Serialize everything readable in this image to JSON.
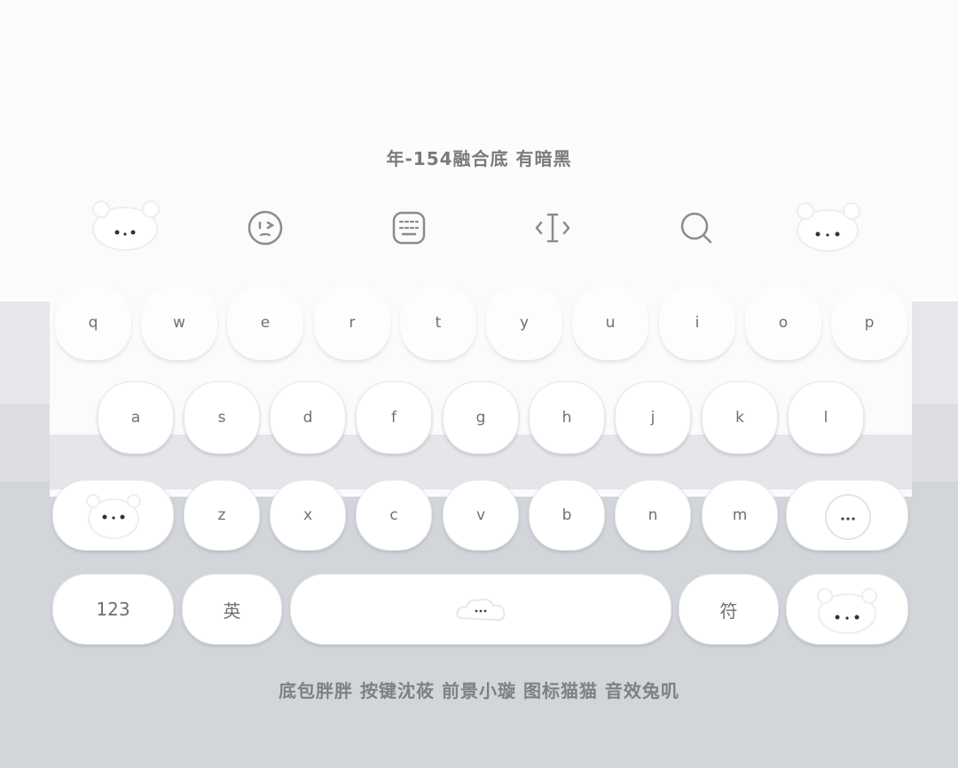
{
  "header": {
    "title": "年-154融合底 有暗黑"
  },
  "toolbar": {
    "items": [
      {
        "name": "bear-sticker-left",
        "icon": "bear-icon"
      },
      {
        "name": "emoji",
        "icon": "emoji-icon"
      },
      {
        "name": "keyboard-layout",
        "icon": "keyboard-icon"
      },
      {
        "name": "cursor",
        "icon": "cursor-icon"
      },
      {
        "name": "search",
        "icon": "search-icon"
      },
      {
        "name": "bear-sticker-right",
        "icon": "bear-icon"
      }
    ]
  },
  "keyboard": {
    "row1": [
      "q",
      "w",
      "e",
      "r",
      "t",
      "y",
      "u",
      "i",
      "o",
      "p"
    ],
    "row2": [
      "a",
      "s",
      "d",
      "f",
      "g",
      "h",
      "j",
      "k",
      "l"
    ],
    "row3": [
      "z",
      "x",
      "c",
      "v",
      "b",
      "n",
      "m"
    ],
    "bottom": {
      "numbers": "123",
      "lang": "英",
      "symbols": "符"
    }
  },
  "footer": {
    "credits": "底包胖胖 按键沈莜 前景小璇 图标猫猫 音效兔叽"
  }
}
